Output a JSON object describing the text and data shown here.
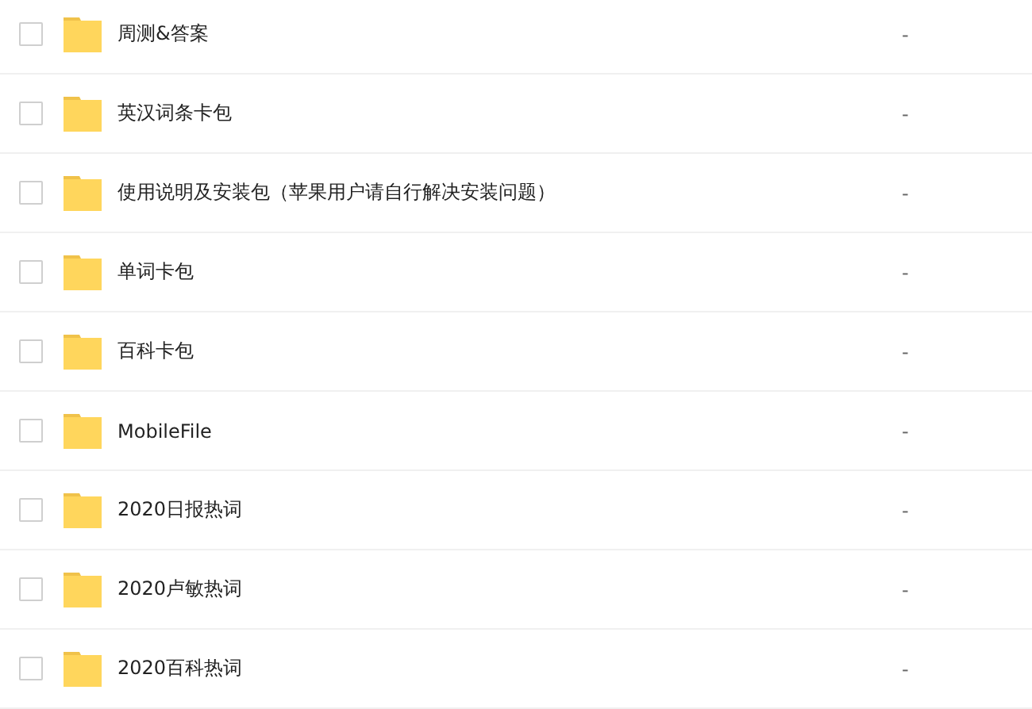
{
  "files": [
    {
      "name": "周测&答案",
      "size": "-",
      "checked": false
    },
    {
      "name": "英汉词条卡包",
      "size": "-",
      "checked": false
    },
    {
      "name": "使用说明及安装包（苹果用户请自行解决安装问题）",
      "size": "-",
      "checked": false
    },
    {
      "name": "单词卡包",
      "size": "-",
      "checked": false
    },
    {
      "name": "百科卡包",
      "size": "-",
      "checked": false
    },
    {
      "name": "MobileFile",
      "size": "-",
      "checked": false
    },
    {
      "name": "2020日报热词",
      "size": "-",
      "checked": false
    },
    {
      "name": "2020卢敏热词",
      "size": "-",
      "checked": false
    },
    {
      "name": "2020百科热词",
      "size": "-",
      "checked": false
    }
  ]
}
